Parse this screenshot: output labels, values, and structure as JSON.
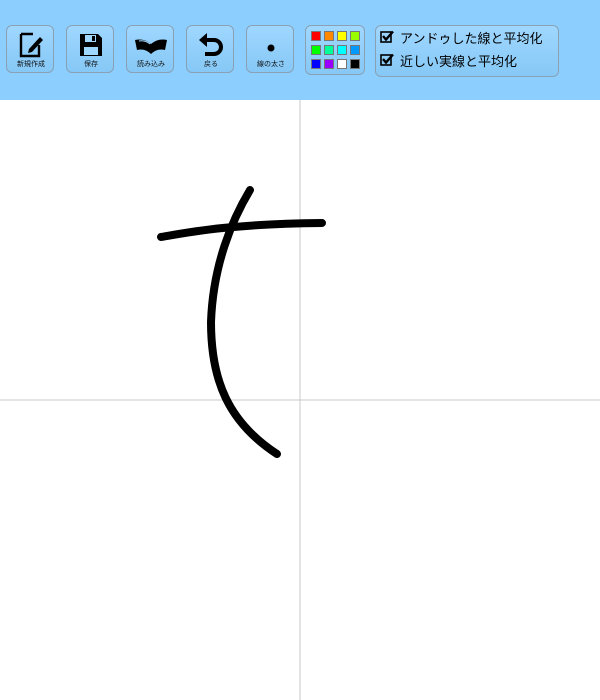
{
  "toolbar": {
    "buttons": [
      {
        "id": "new",
        "label": "新規作成",
        "icon": "new-document-edit-icon"
      },
      {
        "id": "save",
        "label": "保存",
        "icon": "floppy-disk-icon"
      },
      {
        "id": "load",
        "label": "読み込み",
        "icon": "open-book-icon"
      },
      {
        "id": "undo",
        "label": "戻る",
        "icon": "undo-arrow-icon"
      },
      {
        "id": "line-width",
        "label": "線の太さ",
        "icon": "dot-icon"
      }
    ],
    "palette": {
      "colors": [
        "#ff0000",
        "#ff8800",
        "#ffff00",
        "#99ff00",
        "#00ff00",
        "#00ff99",
        "#00ffff",
        "#0099ff",
        "#0000ff",
        "#9900ff",
        "#ffffff",
        "#000000"
      ]
    },
    "options": [
      {
        "label": "アンドゥした線と平均化",
        "checked": true
      },
      {
        "label": "近しい実線と平均化",
        "checked": true
      }
    ]
  },
  "canvas": {
    "background": "#ffffff",
    "guide_color": "#c8c8c8",
    "stroke_color": "#000000"
  }
}
